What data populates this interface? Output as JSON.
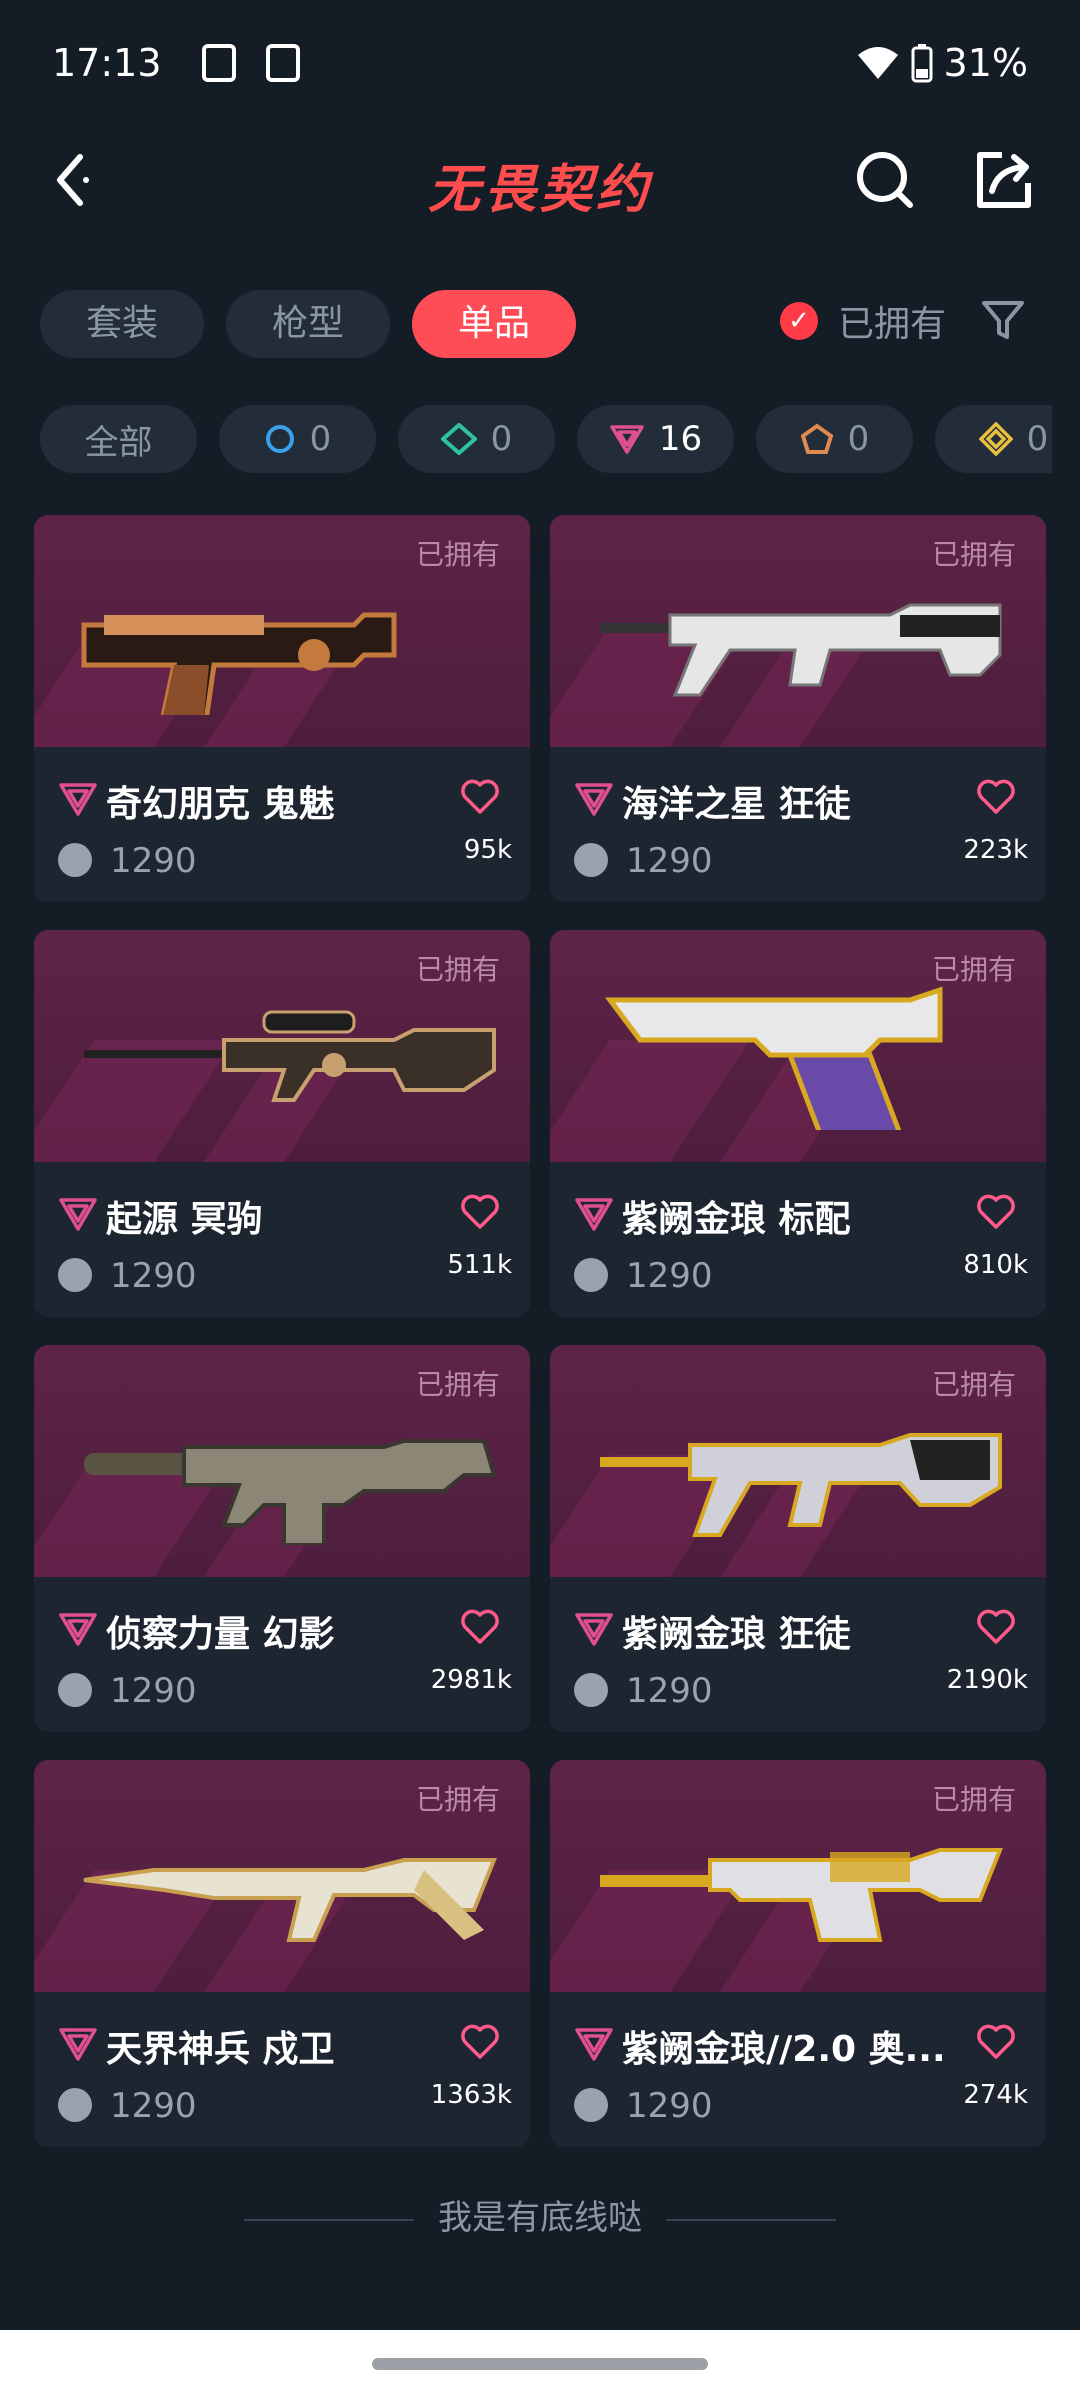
{
  "status_bar": {
    "time": "17:13",
    "battery": "31%"
  },
  "header": {
    "title": "无畏契约"
  },
  "tabs": [
    {
      "label": "套装",
      "active": false
    },
    {
      "label": "枪型",
      "active": false
    },
    {
      "label": "单品",
      "active": true
    }
  ],
  "owned_filter": {
    "label": "已拥有",
    "checked": true
  },
  "tier_chips": [
    {
      "label": "全部",
      "icon": "all"
    },
    {
      "count": "0",
      "icon": "select-tier-icon",
      "color": "#3aa0e8"
    },
    {
      "count": "0",
      "icon": "deluxe-tier-icon",
      "color": "#2ec4a0"
    },
    {
      "count": "16",
      "icon": "premium-tier-icon",
      "color": "#e0508c"
    },
    {
      "count": "0",
      "icon": "exclusive-tier-icon",
      "color": "#e08a50"
    },
    {
      "count": "0",
      "icon": "ultra-tier-icon",
      "color": "#e8c040"
    }
  ],
  "items": [
    {
      "name": "奇幻朋克 鬼魅",
      "price": "1290",
      "likes": "95k",
      "owned": "已拥有",
      "weapon": "ghost"
    },
    {
      "name": "海洋之星 狂徒",
      "price": "1290",
      "likes": "223k",
      "owned": "已拥有",
      "weapon": "vandal"
    },
    {
      "name": "起源 冥驹",
      "price": "1290",
      "likes": "511k",
      "owned": "已拥有",
      "weapon": "operator"
    },
    {
      "name": "紫阙金琅 标配",
      "price": "1290",
      "likes": "810k",
      "owned": "已拥有",
      "weapon": "classic"
    },
    {
      "name": "侦察力量 幻影",
      "price": "1290",
      "likes": "2981k",
      "owned": "已拥有",
      "weapon": "phantom"
    },
    {
      "name": "紫阙金琅 狂徒",
      "price": "1290",
      "likes": "2190k",
      "owned": "已拥有",
      "weapon": "vandal-gold"
    },
    {
      "name": "天界神兵 戍卫",
      "price": "1290",
      "likes": "1363k",
      "owned": "已拥有",
      "weapon": "guardian"
    },
    {
      "name": "紫阙金琅//2.0 奥...",
      "price": "1290",
      "likes": "274k",
      "owned": "已拥有",
      "weapon": "odin"
    }
  ],
  "footer": {
    "text": "我是有底线哒"
  }
}
